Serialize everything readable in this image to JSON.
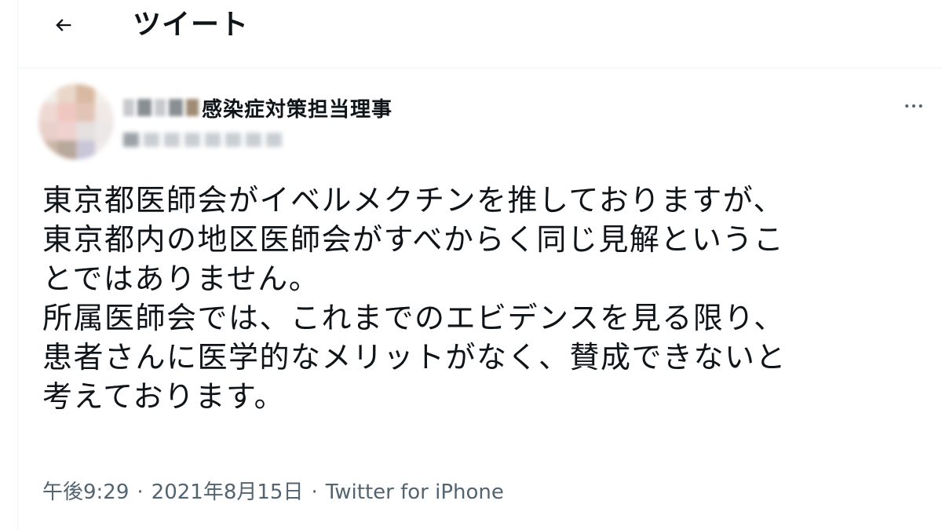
{
  "header": {
    "title": "ツイート"
  },
  "tweet": {
    "display_name": "感染症対策担当理事",
    "text": "東京都医師会がイベルメクチンを推しておりますが、\n東京都内の地区医師会がすべからく同じ見解というこ\nとではありません。\n所属医師会では、これまでのエビデンスを見る限り、\n患者さんに医学的なメリットがなく、賛成できないと\n考えております。",
    "time": "午後9:29",
    "date": "2021年8月15日",
    "source": "Twitter for iPhone",
    "separator": "·"
  },
  "icons": {
    "back": "arrow-left-icon",
    "more": "more-horizontal-icon"
  },
  "colors": {
    "text": "#0f1419",
    "secondary": "#536471",
    "border": "#eff3f4"
  }
}
